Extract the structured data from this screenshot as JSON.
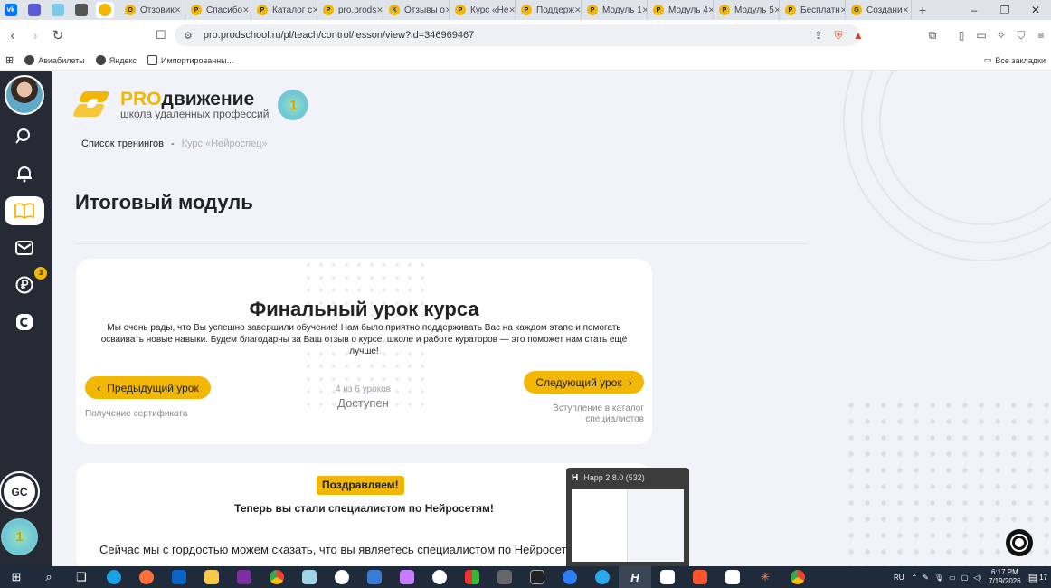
{
  "browser": {
    "tabs": [
      {
        "label": "Отзовик",
        "favicon": "O"
      },
      {
        "label": "Спасибо",
        "favicon": "P"
      },
      {
        "label": "Каталог с",
        "favicon": "P"
      },
      {
        "label": "pro.prods",
        "favicon": "P"
      },
      {
        "label": "Отзывы о",
        "favicon": "K"
      },
      {
        "label": "Курс «Не",
        "favicon": "P"
      },
      {
        "label": "Поддерж",
        "favicon": "P"
      },
      {
        "label": "Модуль 1",
        "favicon": "P"
      },
      {
        "label": "Модуль 4",
        "favicon": "P"
      },
      {
        "label": "Модуль 5",
        "favicon": "P"
      },
      {
        "label": "Бесплатн",
        "favicon": "P"
      },
      {
        "label": "Создани",
        "favicon": "G"
      }
    ],
    "url": "pro.prodschool.ru/pl/teach/control/lesson/view?id=346969467",
    "bookmarks": [
      "Авиабилеты",
      "Яндекс",
      "Импортированны..."
    ],
    "all_bookmarks": "Все закладки"
  },
  "sidebar": {
    "notification_badge": "3"
  },
  "logo": {
    "brand_pro": "PRO",
    "brand_rest": "движение",
    "tagline": "школа удаленных профессий",
    "seal_text": "1"
  },
  "breadcrumb": {
    "root": "Список тренингов",
    "separator": "-",
    "current": "Курс «Нейроспец»"
  },
  "page": {
    "title": "Итоговый модуль"
  },
  "lesson_card": {
    "title": "Финальный урок курса",
    "text": "Мы очень рады, что Вы успешно завершили обучение! Нам было приятно поддерживать Вас на каждом этапе и помогать осваивать новые навыки. Будем благодарны за Ваш отзыв о курсе, школе и работе кураторов — это поможет нам стать ещё лучше!",
    "prev_label": "Предыдущий урок",
    "prev_lesson": "Получение сертификата",
    "next_label": "Следующий урок",
    "next_lesson": "Вступление в каталог специалистов",
    "progress_text": "4 из 6 уроков",
    "status": "Доступен"
  },
  "content": {
    "congrats": "Поздравляем!",
    "subtitle": "Теперь вы стали специалистом по Нейросетям!",
    "paragraph": "Сейчас мы с гордостью можем сказать, что вы являетесь специалистом по Нейросетям"
  },
  "popup": {
    "title": "Happ 2.8.0 (532)",
    "app_letter": "H"
  },
  "taskbar": {
    "lang": "RU",
    "time": "6:17 PM",
    "date": "7/19/2026",
    "notif_count": "17"
  },
  "colors": {
    "accent": "#f2b705",
    "sidebar_bg": "#262a34"
  }
}
